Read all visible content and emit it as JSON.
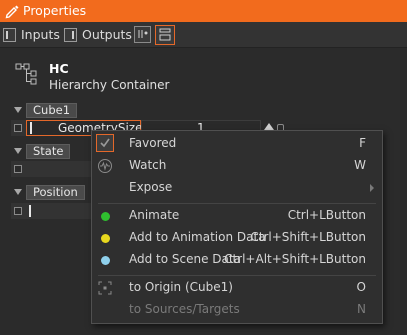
{
  "window": {
    "title": "Properties"
  },
  "toolbar": {
    "inputs_label": "Inputs",
    "outputs_label": "Outputs"
  },
  "hierarchy": {
    "name": "HC",
    "type": "Hierarchy Container"
  },
  "groups": [
    {
      "label": "Cube1"
    },
    {
      "label": "State"
    },
    {
      "label": "Position"
    }
  ],
  "property": {
    "name": "GeometrySizeX",
    "value": "1"
  },
  "context_menu": {
    "items": [
      {
        "label": "Favored",
        "shortcut": "F",
        "icon": "check-icon",
        "checked": true
      },
      {
        "label": "Watch",
        "shortcut": "W",
        "icon": "waveform-icon"
      },
      {
        "label": "Expose",
        "shortcut": "",
        "icon": "submenu-arrow-icon"
      },
      {
        "label": "Animate",
        "shortcut": "Ctrl+LButton",
        "icon": "green-dot-icon",
        "color": "#2fbf2f"
      },
      {
        "label": "Add to Animation Data",
        "shortcut": "Ctrl+Shift+LButton",
        "icon": "yellow-dot-icon",
        "color": "#e8d81e"
      },
      {
        "label": "Add to Scene Data",
        "shortcut": "Ctrl+Alt+Shift+LButton",
        "icon": "blue-dot-icon",
        "color": "#8fd0ec"
      },
      {
        "label": "to Origin (Cube1)",
        "shortcut": "O",
        "icon": "origin-icon"
      },
      {
        "label": "to Sources/Targets",
        "shortcut": "N",
        "icon": "",
        "disabled": true
      }
    ]
  },
  "colors": {
    "accent": "#f26b1d",
    "background": "#2b2b2b"
  }
}
